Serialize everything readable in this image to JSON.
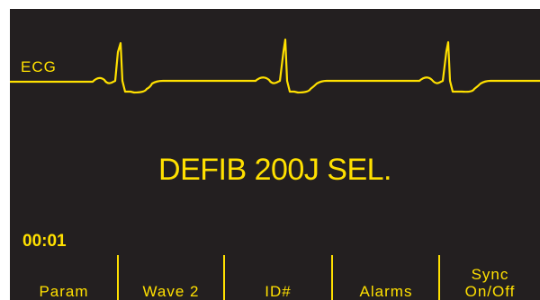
{
  "monitor": {
    "lead_label": "ECG",
    "message": "DEFIB 200J SEL.",
    "elapsed_time": "00:01",
    "trace_color": "#ffe000",
    "background_color": "#231f20"
  },
  "softkeys": [
    {
      "line1": "",
      "line2": "Param"
    },
    {
      "line1": "",
      "line2": "Wave 2"
    },
    {
      "line1": "",
      "line2": "ID#"
    },
    {
      "line1": "",
      "line2": "Alarms"
    },
    {
      "line1": "Sync",
      "line2": "On/Off"
    }
  ]
}
